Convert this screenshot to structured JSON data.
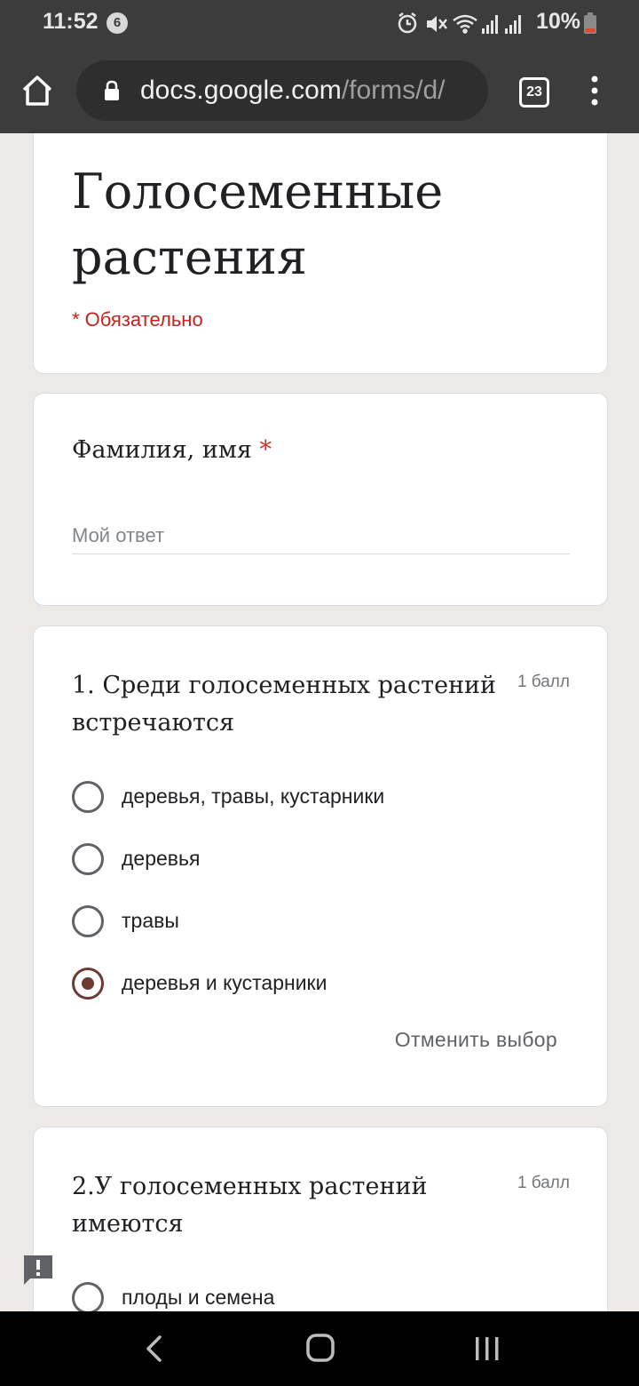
{
  "status_bar": {
    "time": "11:52",
    "notification_count": "6",
    "battery": "10%",
    "icons": [
      "alarm-icon",
      "mute-icon",
      "wifi-icon",
      "signal-icon",
      "signal-icon",
      "battery-low-icon"
    ]
  },
  "browser": {
    "url_host": "docs.google.com",
    "url_path": "/forms/d/",
    "tab_count": "23"
  },
  "form": {
    "title": "Голосеменные растения",
    "required_note": "* Обязательно",
    "name_question": {
      "label": "Фамилия, имя",
      "required_mark": "*",
      "placeholder": "Мой ответ"
    },
    "questions": [
      {
        "text": "1. Среди голосеменных растений встречаются",
        "points": "1 балл",
        "options": [
          {
            "label": "деревья, травы, кустарники",
            "selected": false
          },
          {
            "label": "деревья",
            "selected": false
          },
          {
            "label": "травы",
            "selected": false
          },
          {
            "label": "деревья и кустарники",
            "selected": true
          }
        ],
        "clear_label": "Отменить выбор"
      },
      {
        "text": "2.У голосеменных растений имеются",
        "points": "1 балл",
        "options": [
          {
            "label": "плоды и семена",
            "selected": false
          }
        ]
      }
    ]
  },
  "colors": {
    "accent_radio": "#6d3b34",
    "required": "#d93025",
    "page_background": "#ede9e7",
    "chrome_dark": "#3c3c3c"
  }
}
